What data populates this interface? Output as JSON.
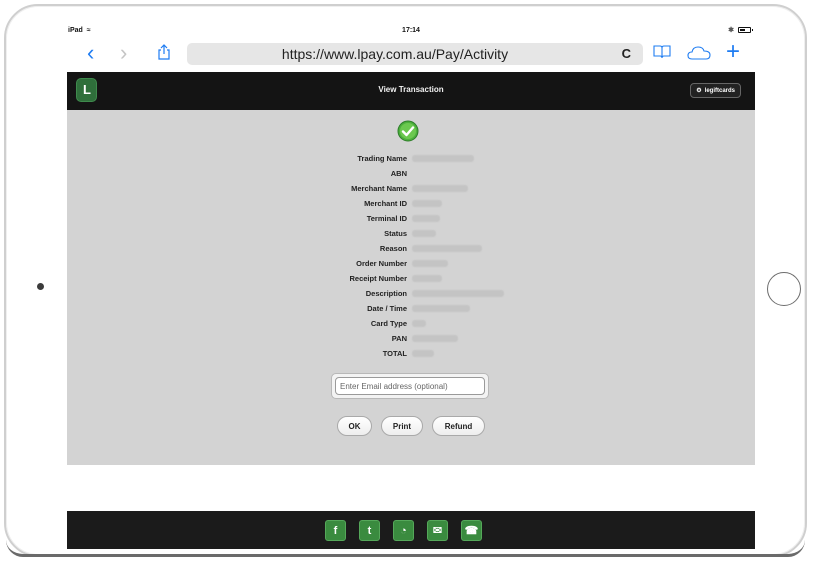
{
  "status_bar": {
    "device": "iPad",
    "time": "17:14"
  },
  "browser": {
    "url": "https://www.lpay.com.au/Pay/Activity",
    "reload_glyph": "C"
  },
  "navbar": {
    "logo_letter": "L",
    "title": "View Transaction",
    "brand_button": "legiftcards"
  },
  "transaction": {
    "labels": [
      "Trading Name",
      "ABN",
      "Merchant Name",
      "Merchant ID",
      "Terminal ID",
      "Status",
      "Reason",
      "Order Number",
      "Receipt Number",
      "Description",
      "Date / Time",
      "Card Type",
      "PAN",
      "TOTAL"
    ]
  },
  "email": {
    "placeholder": "Enter Email address (optional)"
  },
  "actions": {
    "ok": "OK",
    "print": "Print",
    "refund": "Refund"
  },
  "footer": {
    "icons": [
      {
        "name": "facebook-icon",
        "glyph": "f"
      },
      {
        "name": "twitter-icon",
        "glyph": "t"
      },
      {
        "name": "globe-icon",
        "glyph": "◔"
      },
      {
        "name": "email-icon",
        "glyph": "✉"
      },
      {
        "name": "phone-icon",
        "glyph": "☎"
      }
    ]
  },
  "colors": {
    "navbar": "#141414",
    "content_bg": "#d3d3d3",
    "accent_green": "#3a8b3f",
    "safari_blue": "#1e7cf2"
  }
}
